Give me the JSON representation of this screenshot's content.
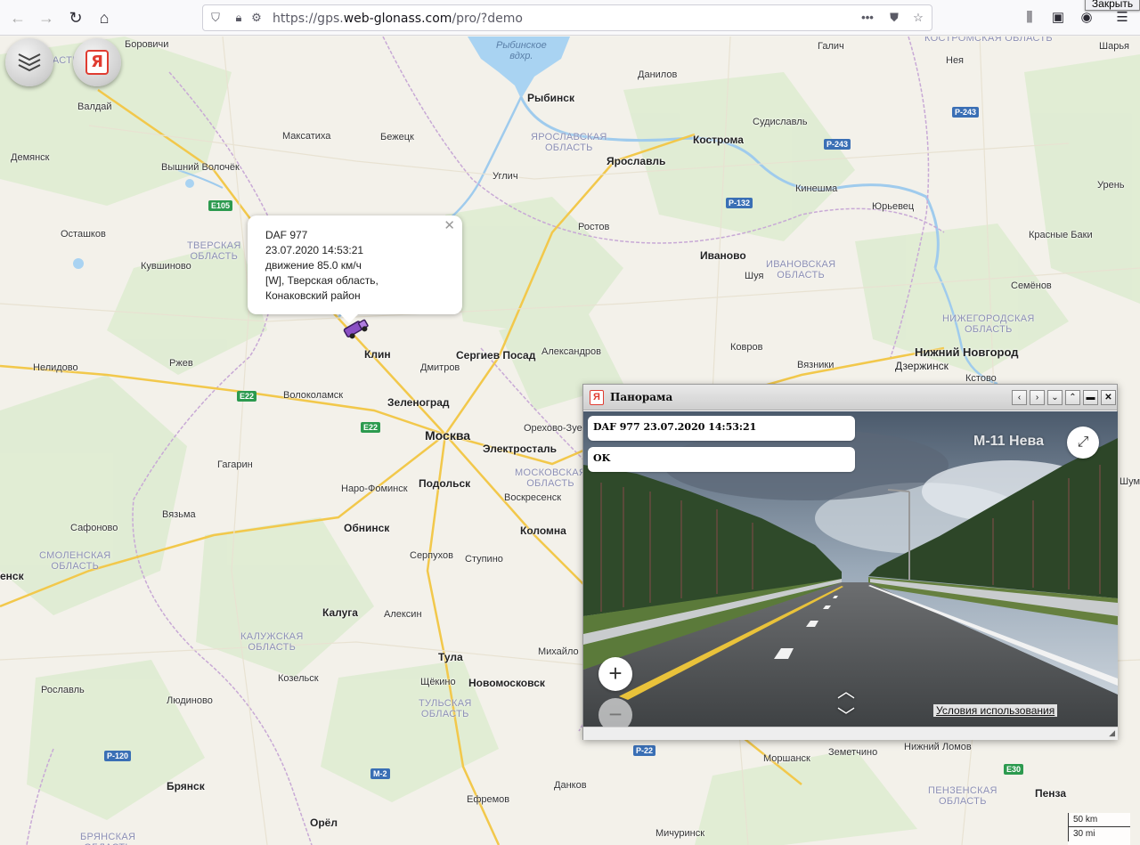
{
  "browser": {
    "url_prefix": "https://gps.",
    "url_domain": "web-glonass.com",
    "url_path": "/pro/?demo",
    "close_tooltip": "Закрыть"
  },
  "popup": {
    "line1": "DAF 977",
    "line2": "23.07.2020 14:53:21",
    "line3": "движение 85.0 км/ч",
    "line4": "[W], Тверская область,",
    "line5": "Конаковский район"
  },
  "panorama": {
    "title": "Панорама",
    "message1": "DAF 977 23.07.2020 14:53:21",
    "message2": "OK",
    "road_label": "М-11 Нева",
    "terms": "Условия использования"
  },
  "scale": {
    "km": "50 km",
    "mi": "30 mi"
  },
  "cities": [
    {
      "name": "Боровичи"
    },
    {
      "name": "Валдай"
    },
    {
      "name": "Демянск"
    },
    {
      "name": "Максатиха"
    },
    {
      "name": "Бежецк"
    },
    {
      "name": "Вышний Волочёк"
    },
    {
      "name": "Осташков"
    },
    {
      "name": "Кувшиново"
    },
    {
      "name": "Рыбинск"
    },
    {
      "name": "Данилов"
    },
    {
      "name": "Галич"
    },
    {
      "name": "Нея"
    },
    {
      "name": "Шарья"
    },
    {
      "name": "Кострома"
    },
    {
      "name": "Судиславль"
    },
    {
      "name": "Ярославль"
    },
    {
      "name": "Углич"
    },
    {
      "name": "Ростов"
    },
    {
      "name": "Кинешма"
    },
    {
      "name": "Юрьевец"
    },
    {
      "name": "Урень"
    },
    {
      "name": "Иваново"
    },
    {
      "name": "Шуя"
    },
    {
      "name": "Красные Баки"
    },
    {
      "name": "Семёнов"
    },
    {
      "name": "Нелидово"
    },
    {
      "name": "Ржев"
    },
    {
      "name": "Клин"
    },
    {
      "name": "Дмитров"
    },
    {
      "name": "Сергиев Посад"
    },
    {
      "name": "Александров"
    },
    {
      "name": "Ковров"
    },
    {
      "name": "Вязники"
    },
    {
      "name": "Нижний Новгород"
    },
    {
      "name": "Дзержинск"
    },
    {
      "name": "Кстово"
    },
    {
      "name": "Волоколамск"
    },
    {
      "name": "Зеленоград"
    },
    {
      "name": "Москва"
    },
    {
      "name": "Электросталь"
    },
    {
      "name": "Орехово-Зуе"
    },
    {
      "name": "Гагарин"
    },
    {
      "name": "Наро-Фоминск"
    },
    {
      "name": "Подольск"
    },
    {
      "name": "Воскресенск"
    },
    {
      "name": "Вязьма"
    },
    {
      "name": "Сафоново"
    },
    {
      "name": "Обнинск"
    },
    {
      "name": "Коломна"
    },
    {
      "name": "Серпухов"
    },
    {
      "name": "Ступино"
    },
    {
      "name": "енск"
    },
    {
      "name": "Калуга"
    },
    {
      "name": "Алексин"
    },
    {
      "name": "Тула"
    },
    {
      "name": "Михайло"
    },
    {
      "name": "Козельск"
    },
    {
      "name": "Щёкино"
    },
    {
      "name": "Новомосковск"
    },
    {
      "name": "Рославль"
    },
    {
      "name": "Людиново"
    },
    {
      "name": "Брянск"
    },
    {
      "name": "Ефремов"
    },
    {
      "name": "Данков"
    },
    {
      "name": "Моршанск"
    },
    {
      "name": "Земетчино"
    },
    {
      "name": "Нижний Ломов"
    },
    {
      "name": "Пенза"
    },
    {
      "name": "Орёл"
    },
    {
      "name": "Мичуринск"
    },
    {
      "name": "Шуме"
    }
  ],
  "regions": [
    {
      "name": "КОСТРОМСКАЯ\nОБЛАСТЬ"
    },
    {
      "name": "ЯРОСЛАВСКАЯ\nОБЛАСТЬ"
    },
    {
      "name": "ТВЕРСКАЯ\nОБЛАСТЬ"
    },
    {
      "name": "ИВАНОВСКАЯ\nОБЛАСТЬ"
    },
    {
      "name": "НИЖЕГОРОДСКАЯ\nОБЛАСТЬ"
    },
    {
      "name": "МОСКОВСКАЯ\nОБЛАСТЬ"
    },
    {
      "name": "СМОЛЕНСКАЯ\nОБЛАСТЬ"
    },
    {
      "name": "КАЛУЖСКАЯ\nОБЛАСТЬ"
    },
    {
      "name": "ТУЛЬСКАЯ\nОБЛАСТЬ"
    },
    {
      "name": "ПЕНЗЕНСКАЯ\nОБЛАСТЬ"
    },
    {
      "name": "БРЯНСКАЯ\nОБЛАСТЬ"
    },
    {
      "name": "ОБЛАСТЬ"
    }
  ],
  "water": {
    "name": "Рыбинское\nвдхр."
  },
  "road_shields": [
    {
      "name": "E105"
    },
    {
      "name": "E22"
    },
    {
      "name": "E22"
    },
    {
      "name": "P-243"
    },
    {
      "name": "P-243"
    },
    {
      "name": "P-132"
    },
    {
      "name": "P-120"
    },
    {
      "name": "M-2"
    },
    {
      "name": "P-22"
    },
    {
      "name": "E30"
    }
  ]
}
